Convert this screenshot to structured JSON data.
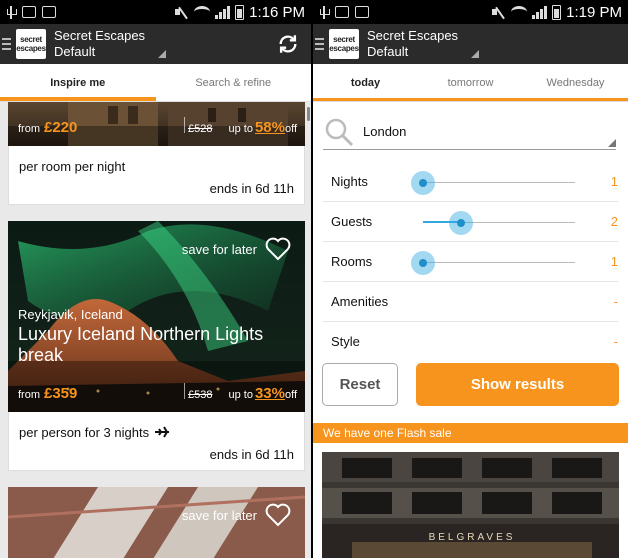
{
  "status_left": {
    "time": "1:16 PM"
  },
  "status_right": {
    "time": "1:19 PM"
  },
  "app": {
    "title": "Secret Escapes",
    "subtitle": "Default",
    "logo_line1": "secret",
    "logo_line2": "escapes"
  },
  "left_tabs": [
    {
      "label": "Inspire me"
    },
    {
      "label": "Search & refine"
    }
  ],
  "right_tabs": [
    {
      "label": "today"
    },
    {
      "label": "tomorrow"
    },
    {
      "label": "Wednesday"
    }
  ],
  "deals": [
    {
      "from_label": "from",
      "price": "£220",
      "old_price": "£528",
      "upto_label": "up to",
      "discount": "58%",
      "off_label": "off",
      "per_text": "per room per night",
      "ends_text": "ends in 6d 11h"
    },
    {
      "location": "Reykjavik, Iceland",
      "title": "Luxury Iceland Northern Lights break",
      "save_label": "save for later",
      "from_label": "from",
      "price": "£359",
      "old_price": "£538",
      "upto_label": "up to",
      "discount": "33%",
      "off_label": "off",
      "per_text": "per person for 3 nights",
      "ends_text": "ends in 6d 11h"
    },
    {
      "save_label": "save for later"
    }
  ],
  "search": {
    "value": "London"
  },
  "filters": [
    {
      "label": "Nights",
      "value": "1",
      "slider_fraction": 0.0
    },
    {
      "label": "Guests",
      "value": "2",
      "slider_fraction": 0.25
    },
    {
      "label": "Rooms",
      "value": "1",
      "slider_fraction": 0.0
    },
    {
      "label": "Amenities",
      "value": "-"
    },
    {
      "label": "Style",
      "value": "-"
    }
  ],
  "buttons": {
    "reset": "Reset",
    "show_results": "Show results"
  },
  "flash": {
    "banner": "We have one Flash sale",
    "sign_text": "BELGRAVES"
  },
  "colors": {
    "accent": "#f7941d",
    "slider": "#33a8e0",
    "actionbar": "#2b2b2b"
  }
}
